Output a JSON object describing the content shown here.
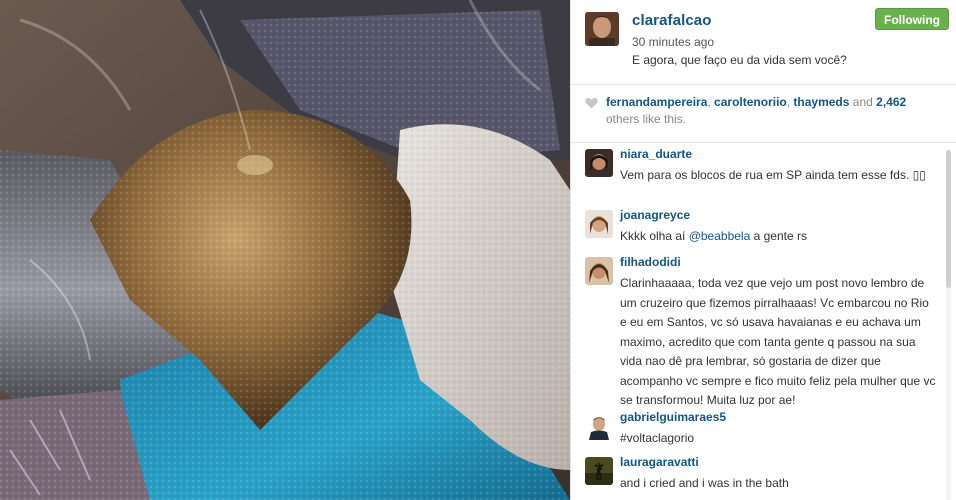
{
  "post": {
    "username": "clarafalcao",
    "time": "30 minutes ago",
    "caption": "E agora, que faço eu da vida sem você?",
    "follow_label": "Following",
    "follow_color": "#6bb04f"
  },
  "likes": {
    "user1": "fernandampereira",
    "sep1": ", ",
    "user2": "caroltenoriio",
    "sep2": ", ",
    "user3": "thaymeds",
    "and": " and ",
    "count": "2,462",
    "suffix": " others like this."
  },
  "comments": [
    {
      "user": "niara_duarte",
      "text": "Vem para os blocos de rua em SP ainda tem esse fds. ▯▯"
    },
    {
      "user": "joanagreyce",
      "text_before": "Kkkk olha aí ",
      "mention": "@beabbela",
      "text_after": " a gente rs"
    },
    {
      "user": "filhadodidi",
      "text": "Clarinhaaaaa, toda vez que vejo um post novo lembro de um cruzeiro que fizemos pirralhaaas! Vc embarcou no Rio e eu em Santos, vc só usava havaianas e eu achava um maximo, acredito que com tanta gente q passou na sua vida nao dê pra lembrar, só gostaria de dizer que acompanho vc sempre e fico muito feliz pela mulher que vc se transformou! Muita luz por ae!"
    },
    {
      "user": "gabrielguimaraes5",
      "text": "#voltaclagorio"
    },
    {
      "user": "lauragaravatti",
      "text": "and i cried and i was in the bath"
    }
  ],
  "colors": {
    "link": "#125688",
    "heart": "#c7c7c7"
  }
}
